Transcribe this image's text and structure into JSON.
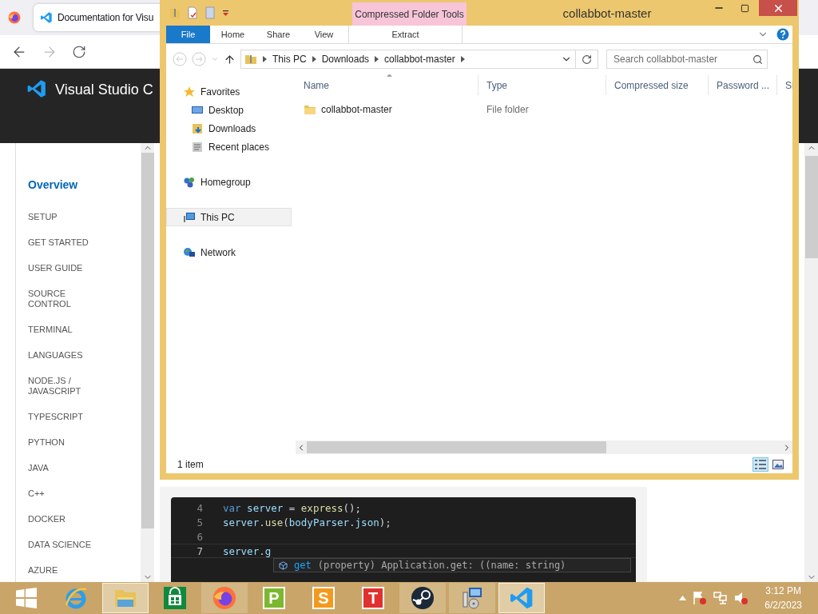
{
  "browser": {
    "tab": {
      "title": "Documentation for Visu",
      "selected": true
    },
    "site_title": "Visual Studio C",
    "docs_nav": [
      {
        "label": "Overview",
        "selected": true
      },
      {
        "label": "SETUP",
        "selected": false
      },
      {
        "label": "GET STARTED",
        "selected": false
      },
      {
        "label": "USER GUIDE",
        "selected": false
      },
      {
        "label": "SOURCE CONTROL",
        "selected": false
      },
      {
        "label": "TERMINAL",
        "selected": false
      },
      {
        "label": "LANGUAGES",
        "selected": false
      },
      {
        "label": "NODE.JS / JAVASCRIPT",
        "selected": false
      },
      {
        "label": "TYPESCRIPT",
        "selected": false
      },
      {
        "label": "PYTHON",
        "selected": false
      },
      {
        "label": "JAVA",
        "selected": false
      },
      {
        "label": "C++",
        "selected": false
      },
      {
        "label": "DOCKER",
        "selected": false
      },
      {
        "label": "DATA SCIENCE",
        "selected": false
      },
      {
        "label": "AZURE",
        "selected": false
      }
    ],
    "code": {
      "lines": [
        {
          "number": "4",
          "tokens": [
            {
              "kind": "keyword",
              "text": "var "
            },
            {
              "kind": "variable",
              "text": "server"
            },
            {
              "kind": "plain",
              "text": " = "
            },
            {
              "kind": "function",
              "text": "express"
            },
            {
              "kind": "plain",
              "text": "();"
            }
          ]
        },
        {
          "number": "5",
          "tokens": [
            {
              "kind": "variable",
              "text": "server"
            },
            {
              "kind": "plain",
              "text": "."
            },
            {
              "kind": "function",
              "text": "use"
            },
            {
              "kind": "plain",
              "text": "("
            },
            {
              "kind": "variable",
              "text": "bodyParser"
            },
            {
              "kind": "plain",
              "text": "."
            },
            {
              "kind": "variable",
              "text": "json"
            },
            {
              "kind": "plain",
              "text": ");"
            }
          ]
        },
        {
          "number": "6"
        },
        {
          "number": "7",
          "tokens": [
            {
              "kind": "variable",
              "text": "server"
            },
            {
              "kind": "plain",
              "text": "."
            },
            {
              "kind": "variable",
              "text": "g"
            }
          ],
          "current": true
        }
      ],
      "suggestion": {
        "name": "get",
        "detail": "(property) Application.get: ((name: string)"
      }
    }
  },
  "explorer": {
    "title": "collabbot-master",
    "context_tab": "Compressed Folder Tools",
    "ribbon_tabs": [
      {
        "label": "File",
        "kind": "file",
        "selected": false
      },
      {
        "label": "Home",
        "kind": "tab",
        "selected": false
      },
      {
        "label": "Share",
        "kind": "tab",
        "selected": false
      },
      {
        "label": "View",
        "kind": "tab",
        "selected": false
      },
      {
        "label": "Extract",
        "kind": "context",
        "selected": false
      }
    ],
    "breadcrumbs": [
      "This PC",
      "Downloads",
      "collabbot-master"
    ],
    "search": {
      "placeholder": "Search collabbot-master"
    },
    "nav": [
      {
        "label": "Favorites",
        "selected": false,
        "children": [
          {
            "label": "Desktop",
            "selected": false
          },
          {
            "label": "Downloads",
            "selected": false
          },
          {
            "label": "Recent places",
            "selected": false
          }
        ]
      },
      {
        "label": "Homegroup",
        "selected": false
      },
      {
        "label": "This PC",
        "selected": true
      },
      {
        "label": "Network",
        "selected": false
      }
    ],
    "columns": [
      {
        "label": "Name",
        "sorted": true
      },
      {
        "label": "Type",
        "sorted": false
      },
      {
        "label": "Compressed size",
        "sorted": false
      },
      {
        "label": "Password ...",
        "sorted": false
      },
      {
        "label": "Si",
        "sorted": false
      }
    ],
    "rows": [
      {
        "cells": [
          "collabbot-master",
          "File folder"
        ]
      }
    ],
    "status": "1 item",
    "views": [
      {
        "kind": "details",
        "selected": true
      },
      {
        "kind": "tiles",
        "selected": false
      }
    ]
  },
  "taskbar": {
    "apps": [
      {
        "kind": "ie",
        "running": false,
        "selected": false
      },
      {
        "kind": "explorer",
        "running": true,
        "selected": true
      },
      {
        "kind": "store",
        "running": false,
        "selected": false
      },
      {
        "kind": "firefox",
        "running": true,
        "selected": false
      },
      {
        "kind": "letter",
        "letter": "P",
        "color": "#7cb82f",
        "running": false,
        "selected": false
      },
      {
        "kind": "letter",
        "letter": "S",
        "color": "#f39a1e",
        "running": false,
        "selected": false
      },
      {
        "kind": "letter",
        "letter": "T",
        "color": "#e0312f",
        "running": false,
        "selected": false
      },
      {
        "kind": "steam",
        "running": true,
        "selected": false
      },
      {
        "kind": "setup",
        "running": true,
        "selected": false
      },
      {
        "kind": "vscode",
        "running": true,
        "selected": true
      }
    ],
    "time": "3:12 PM",
    "date": "6/2/2023"
  }
}
